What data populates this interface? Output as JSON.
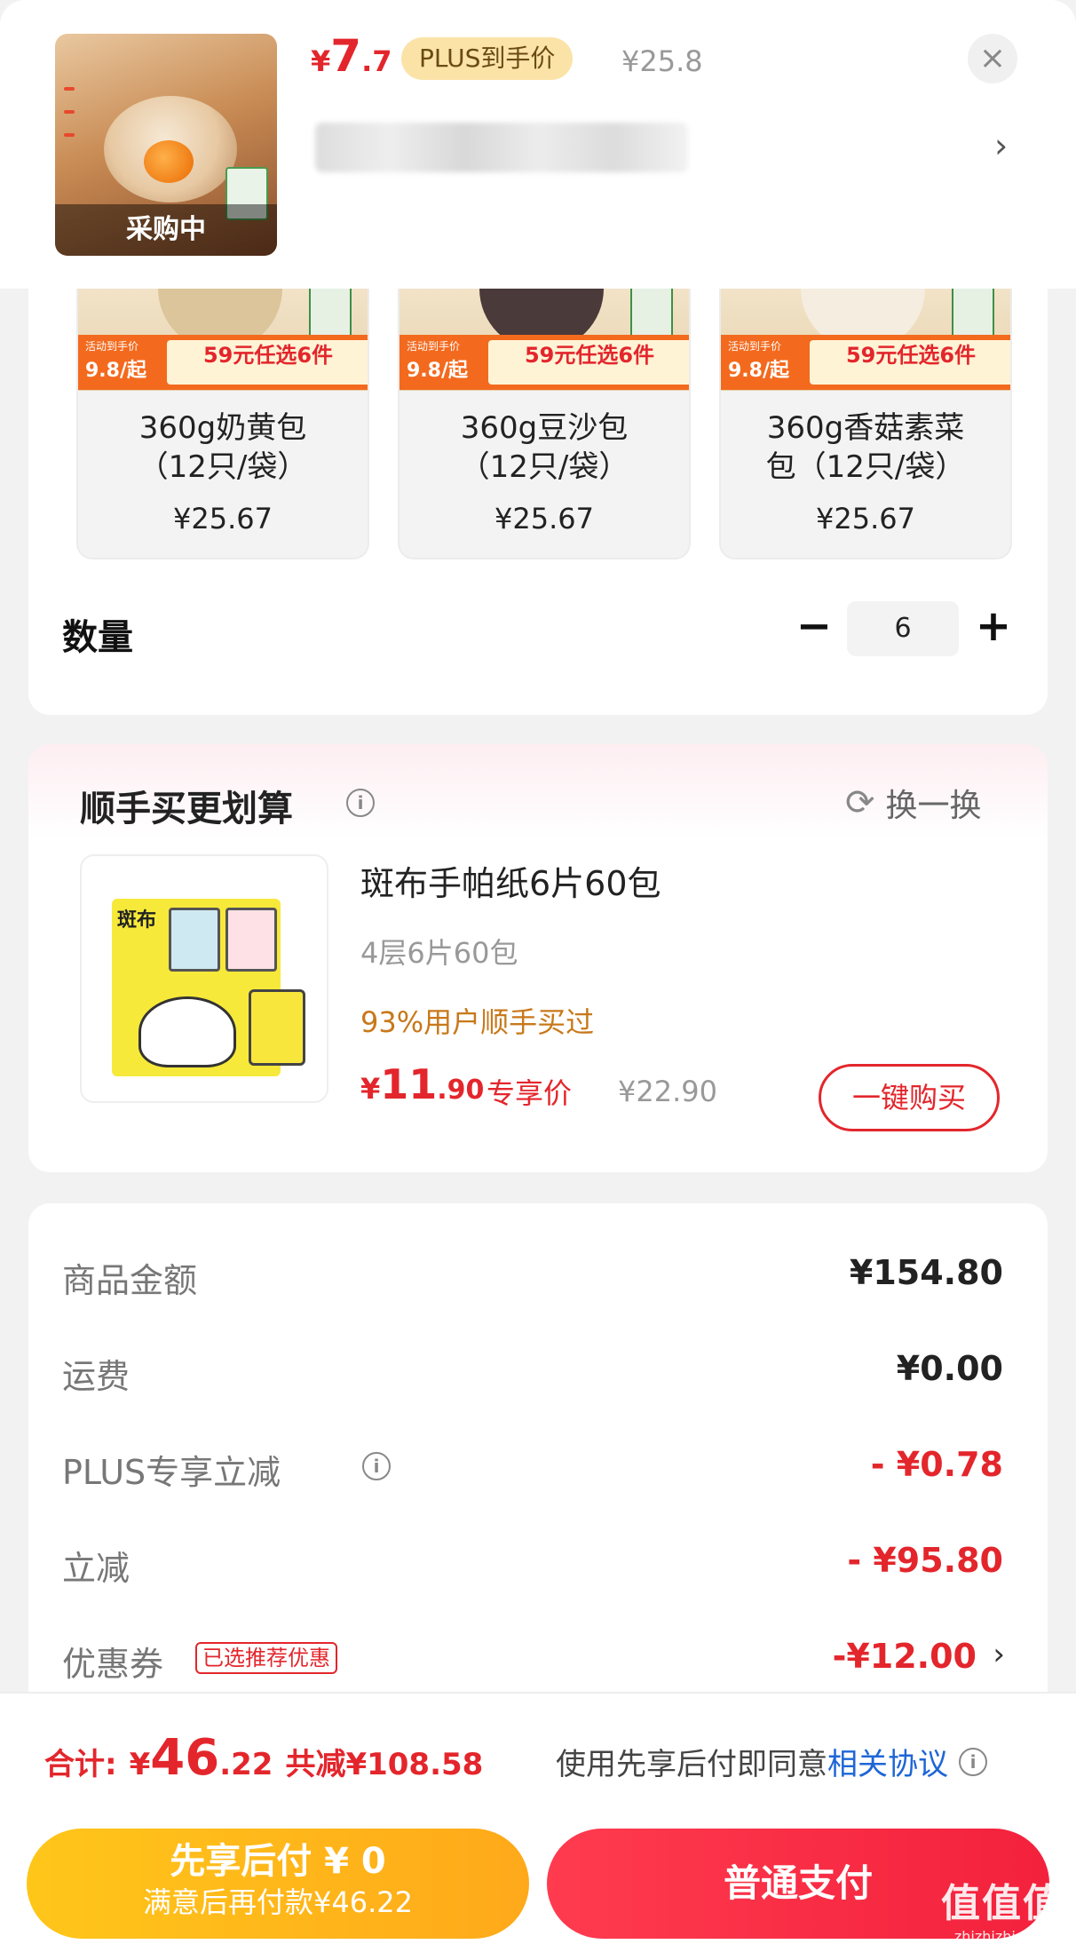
{
  "header": {
    "thumb_badge": "采购中",
    "price_currency": "¥",
    "price_int": "7",
    "price_dec": ".7",
    "plus_label": "PLUS到手价",
    "original_price": "¥25.8"
  },
  "products": [
    {
      "promo_activity": "活动到手价",
      "promo_from": "9.8/起",
      "promo_deal": "59元任选6件",
      "name_line1": "360g奶黄包",
      "name_line2": "（12只/袋）",
      "price": "¥25.67"
    },
    {
      "promo_activity": "活动到手价",
      "promo_from": "9.8/起",
      "promo_deal": "59元任选6件",
      "name_line1": "360g豆沙包",
      "name_line2": "（12只/袋）",
      "price": "¥25.67"
    },
    {
      "promo_activity": "活动到手价",
      "promo_from": "9.8/起",
      "promo_deal": "59元任选6件",
      "name_line1": "360g香菇素菜",
      "name_line2": "包（12只/袋）",
      "price": "¥25.67"
    }
  ],
  "quantity": {
    "label": "数量",
    "minus": "−",
    "value": "6",
    "plus": "+"
  },
  "addon": {
    "title": "顺手买更划算",
    "refresh_label": "换一换",
    "brand": "斑布",
    "name": "斑布手帕纸6片60包",
    "sub": "4层6片60包",
    "social": "93%用户顺手买过",
    "price_currency": "¥",
    "price_int": "11",
    "price_dec": ".90",
    "exclusive": "专享价",
    "original": "¥22.90",
    "buy_button": "一键购买"
  },
  "summary": {
    "goods_label": "商品金额",
    "goods_value": "¥154.80",
    "shipping_label": "运费",
    "shipping_value": "¥0.00",
    "plus_label": "PLUS专享立减",
    "plus_value": "- ¥0.78",
    "discount_label": "立减",
    "discount_value": "- ¥95.80",
    "coupon_label": "优惠券",
    "coupon_tag": "已选推荐优惠",
    "coupon_value": "-¥12.00"
  },
  "footer": {
    "total_label": "合计:",
    "total_currency": "¥",
    "total_int": "46",
    "total_dec": ".22",
    "saved": "共减¥108.58",
    "agree_text": "使用先享后付即同意",
    "agree_link": "相关协议",
    "pay_later_line1": "先享后付 ¥ 0",
    "pay_later_line2": "满意后再付款¥46.22",
    "pay_normal": "普通支付",
    "watermark_main": "值值值",
    "watermark_sub": "zhizhizhi.com"
  },
  "colors": {
    "accent_red": "#e3262c",
    "pay_later_yellow": "#ffb81a",
    "link_blue": "#1e66d6"
  }
}
